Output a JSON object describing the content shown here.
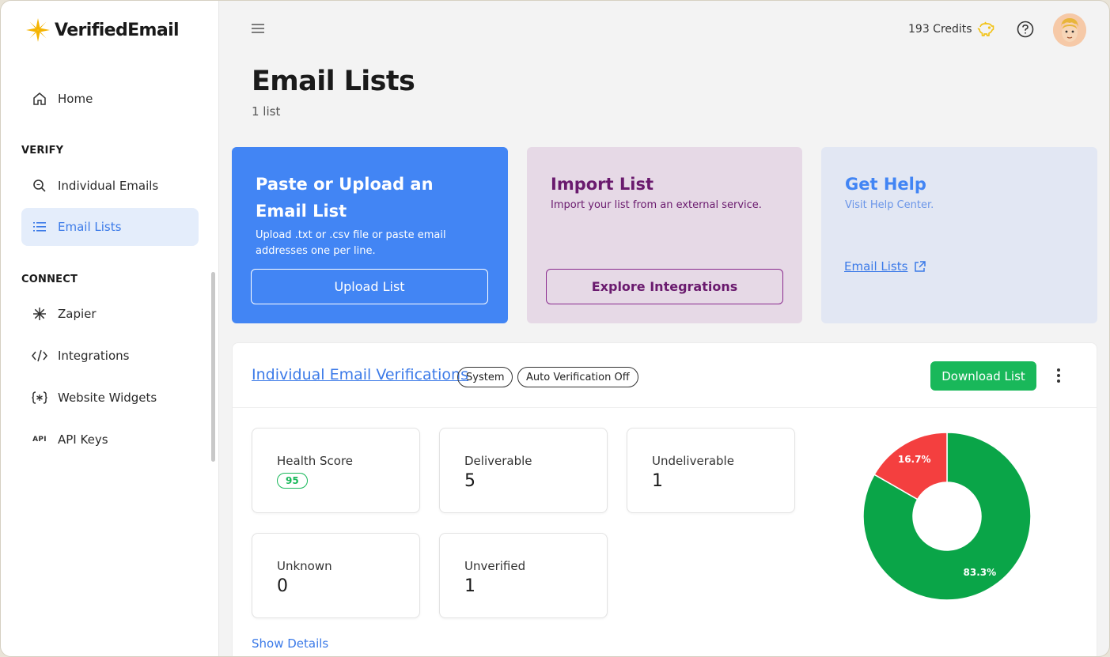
{
  "app": {
    "logo_text": "VerifiedEmail"
  },
  "sidebar": {
    "items": [
      {
        "label": "Home",
        "icon": "home-icon"
      },
      {
        "label": "Individual Emails",
        "icon": "search-icon"
      },
      {
        "label": "Email Lists",
        "icon": "list-icon",
        "active": true
      },
      {
        "label": "Zapier",
        "icon": "zapier-icon"
      },
      {
        "label": "Integrations",
        "icon": "code-icon"
      },
      {
        "label": "Website Widgets",
        "icon": "widget-icon"
      },
      {
        "label": "API Keys",
        "icon": "api-icon",
        "icon_text": "API"
      }
    ],
    "sections": {
      "verify": "VERIFY",
      "connect": "CONNECT"
    }
  },
  "header": {
    "credits": "193 Credits",
    "credits_icon": "piggy-bank-icon",
    "help_icon": "help-icon"
  },
  "page": {
    "title": "Email Lists",
    "subtitle": "1 list"
  },
  "cards": {
    "upload": {
      "title": "Paste or Upload an Email List",
      "desc": "Upload .txt or .csv file or paste email addresses one per line.",
      "button": "Upload List"
    },
    "import": {
      "title": "Import List",
      "desc": "Import your list from an external service.",
      "button": "Explore Integrations"
    },
    "help": {
      "title": "Get Help",
      "desc": "Visit Help Center.",
      "link": "Email Lists"
    }
  },
  "list": {
    "title": "Individual Email Verifications",
    "chips": [
      "System",
      "Auto Verification Off"
    ],
    "download": "Download List",
    "stats": {
      "health_label": "Health Score",
      "health_value": "95",
      "deliverable_label": "Deliverable",
      "deliverable_value": "5",
      "undeliverable_label": "Undeliverable",
      "undeliverable_value": "1",
      "unknown_label": "Unknown",
      "unknown_value": "0",
      "unverified_label": "Unverified",
      "unverified_value": "1"
    },
    "show_details": "Show Details"
  },
  "colors": {
    "primary": "#4285f4",
    "success": "#19b85a",
    "danger": "#f43f3f",
    "donut_green": "#0aa548"
  },
  "chart_data": {
    "type": "pie",
    "donut": true,
    "categories": [
      "Deliverable",
      "Undeliverable"
    ],
    "values": [
      83.3,
      16.7
    ],
    "labels": [
      "83.3%",
      "16.7%"
    ],
    "colors": [
      "#0aa548",
      "#f43f3f"
    ]
  }
}
